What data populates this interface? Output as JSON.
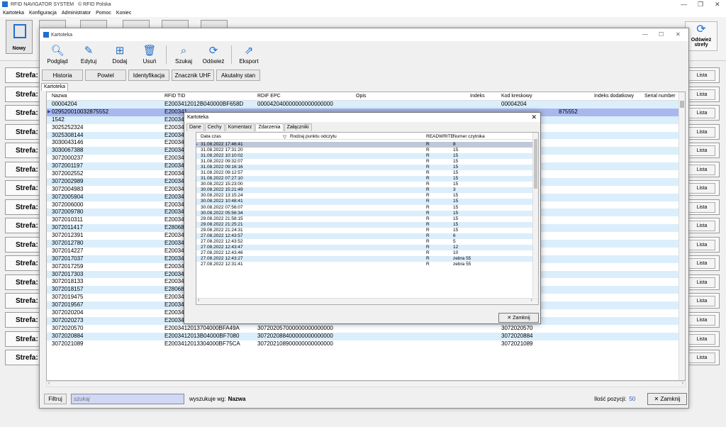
{
  "app": {
    "title": "RFID NAVIGATOR SYSTEM",
    "vendor": "© RFID Polska",
    "menu": [
      "Kartoteka",
      "Konfiguracja",
      "Administrator",
      "Pomoc",
      "Koniec"
    ],
    "new_label": "Nowy",
    "refresh_zones_label": "Odśwież strefy",
    "zone_label": "Strefa:",
    "list_label": "Lista",
    "accent": "#1e6fd0"
  },
  "kartoteka": {
    "title": "Kartoteka",
    "toolbar": {
      "preview": "Podgląd",
      "edit": "Edytuj",
      "add": "Dodaj",
      "delete": "Usuń",
      "search": "Szukaj",
      "refresh": "Odśwież",
      "export": "Eksport"
    },
    "subbar": {
      "history": "Historia",
      "duplicate": "Powiel",
      "identify": "Identyfikacja",
      "uhf": "Znacznik UHF",
      "state": "Akutalny stan"
    },
    "tab": "Kartoteka",
    "columns": [
      "Nazwa",
      "RFID TID",
      "RDIF EPC",
      "Opis",
      "Indeks",
      "Kod kreskowy",
      "Indeks dodatkowy",
      "Serial number"
    ],
    "rows": [
      {
        "name": "00004204",
        "tid": "E2003412012B040000BF658D",
        "epc": "000042040000000000000000",
        "code": "00004204"
      },
      {
        "name": "029520010032875552",
        "tid": "E200341",
        "epc": "",
        "code": "875552"
      },
      {
        "name": "1542",
        "tid": "E200341",
        "epc": "",
        "code": ""
      },
      {
        "name": "3025252324",
        "tid": "E200341",
        "epc": "",
        "code": ""
      },
      {
        "name": "3025308144",
        "tid": "E200341",
        "epc": "",
        "code": ""
      },
      {
        "name": "3030043146",
        "tid": "E200341",
        "epc": "",
        "code": ""
      },
      {
        "name": "3030067388",
        "tid": "E200341",
        "epc": "",
        "code": ""
      },
      {
        "name": "3072000237",
        "tid": "E200341",
        "epc": "",
        "code": ""
      },
      {
        "name": "3072001197",
        "tid": "E200341",
        "epc": "",
        "code": ""
      },
      {
        "name": "3072002552",
        "tid": "E200341",
        "epc": "",
        "code": ""
      },
      {
        "name": "3072002989",
        "tid": "E200341",
        "epc": "",
        "code": ""
      },
      {
        "name": "3072004983",
        "tid": "E200341",
        "epc": "",
        "code": ""
      },
      {
        "name": "3072005904",
        "tid": "E200341",
        "epc": "",
        "code": ""
      },
      {
        "name": "3072006000",
        "tid": "E200341",
        "epc": "",
        "code": ""
      },
      {
        "name": "3072009780",
        "tid": "E200341",
        "epc": "",
        "code": ""
      },
      {
        "name": "3072010311",
        "tid": "E200341",
        "epc": "",
        "code": ""
      },
      {
        "name": "3072011417",
        "tid": "E280689",
        "epc": "",
        "code": ""
      },
      {
        "name": "3072012391",
        "tid": "E200341",
        "epc": "",
        "code": ""
      },
      {
        "name": "3072012780",
        "tid": "E200341",
        "epc": "",
        "code": ""
      },
      {
        "name": "3072014227",
        "tid": "E200341",
        "epc": "",
        "code": ""
      },
      {
        "name": "3072017037",
        "tid": "E200341",
        "epc": "",
        "code": ""
      },
      {
        "name": "3072017259",
        "tid": "E200341",
        "epc": "",
        "code": ""
      },
      {
        "name": "3072017303",
        "tid": "E200341",
        "epc": "",
        "code": ""
      },
      {
        "name": "3072018133",
        "tid": "E200341",
        "epc": "",
        "code": ""
      },
      {
        "name": "3072018157",
        "tid": "E280689",
        "epc": "",
        "code": ""
      },
      {
        "name": "3072019475",
        "tid": "E200341",
        "epc": "",
        "code": ""
      },
      {
        "name": "3072019567",
        "tid": "E2003412012E040000C01BF8",
        "epc": "307201956700000000000000",
        "code": "3072019567"
      },
      {
        "name": "3072020204",
        "tid": "E2003412013704000BF8780",
        "epc": "307202020400000000000000",
        "code": "3072020204"
      },
      {
        "name": "3072020273",
        "tid": "E2003412013904000BF3C6B",
        "epc": "307202027300000000000000",
        "code": "3072020273"
      },
      {
        "name": "3072020570",
        "tid": "E2003412013704000BFA49A",
        "epc": "307202057000000000000000",
        "code": "3072020570"
      },
      {
        "name": "3072020884",
        "tid": "E2003412013B04000BF7080",
        "epc": "307202088400000000000000",
        "code": "3072020884"
      },
      {
        "name": "3072021089",
        "tid": "E2003412013304000BF75CA",
        "epc": "307202108900000000000000",
        "code": "3072021089"
      }
    ],
    "filter_label": "Filtruj",
    "search_placeholder": "szukaj",
    "search_by_label": "wyszukuje wg:",
    "search_by_field": "Nazwa",
    "count_label": "Ilość pozycji:",
    "count_value": "50",
    "close_label": "Zamknij"
  },
  "dialog": {
    "title": "Kartoteka",
    "tabs": [
      "Dane",
      "Cechy",
      "Komentarz",
      "Zdarzenia",
      "Załączniki"
    ],
    "active_tab": "Zdarzenia",
    "columns": [
      "Data czas",
      "Rodzaj punktu odczytu",
      "READWRITE",
      "Numer czytnika"
    ],
    "rows": [
      {
        "dt": "31.08.2022 17:46:41",
        "rw": "R",
        "reader": "8"
      },
      {
        "dt": "31.08.2022 17:31:20",
        "rw": "R",
        "reader": "15"
      },
      {
        "dt": "31.08.2022 10:10:02",
        "rw": "R",
        "reader": "15"
      },
      {
        "dt": "31.08.2022 09:32:07",
        "rw": "R",
        "reader": "15"
      },
      {
        "dt": "31.08.2022 09:16:16",
        "rw": "R",
        "reader": "15"
      },
      {
        "dt": "31.08.2022 09:12:57",
        "rw": "R",
        "reader": "15"
      },
      {
        "dt": "31.08.2022 07:27:10",
        "rw": "R",
        "reader": "15"
      },
      {
        "dt": "30.08.2022 15:23:00",
        "rw": "R",
        "reader": "15"
      },
      {
        "dt": "30.08.2022 15:21:49",
        "rw": "R",
        "reader": "3"
      },
      {
        "dt": "30.08.2022 13:15:24",
        "rw": "R",
        "reader": "15"
      },
      {
        "dt": "30.08.2022 10:48:41",
        "rw": "R",
        "reader": "15"
      },
      {
        "dt": "30.08.2022 07:56:07",
        "rw": "R",
        "reader": "15"
      },
      {
        "dt": "30.08.2022 05:56:34",
        "rw": "R",
        "reader": "15"
      },
      {
        "dt": "29.08.2022 21:58:15",
        "rw": "R",
        "reader": "15"
      },
      {
        "dt": "29.08.2022 21:25:21",
        "rw": "R",
        "reader": "15"
      },
      {
        "dt": "29.08.2022 21:24:31",
        "rw": "R",
        "reader": "15"
      },
      {
        "dt": "27.08.2022 12:43:57",
        "rw": "R",
        "reader": "6"
      },
      {
        "dt": "27.08.2022 12:43:52",
        "rw": "R",
        "reader": "5"
      },
      {
        "dt": "27.08.2022 12:43:47",
        "rw": "R",
        "reader": "12"
      },
      {
        "dt": "27.08.2022 12:43:46",
        "rw": "R",
        "reader": "10"
      },
      {
        "dt": "27.08.2022 12:43:27",
        "rw": "R",
        "reader": "zebra 55"
      },
      {
        "dt": "27.08.2022 12:31:41",
        "rw": "R",
        "reader": "zebra 55"
      }
    ],
    "close_label": "Zamknij"
  }
}
